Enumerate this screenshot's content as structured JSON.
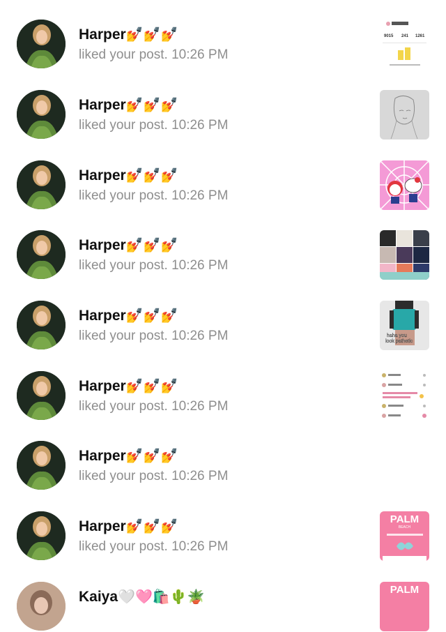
{
  "notifications": [
    {
      "user": "Harper",
      "emoji": "💅💅💅",
      "action": "liked your post.",
      "time": "10:26 PM",
      "thumb": "stats-screenshot",
      "thumb_text": [
        "9015",
        "241",
        "1261"
      ]
    },
    {
      "user": "Harper",
      "emoji": "💅💅💅",
      "action": "liked your post.",
      "time": "10:26 PM",
      "thumb": "pencil-sketch"
    },
    {
      "user": "Harper",
      "emoji": "💅💅💅",
      "action": "liked your post.",
      "time": "10:26 PM",
      "thumb": "pink-cartoon"
    },
    {
      "user": "Harper",
      "emoji": "💅💅💅",
      "action": "liked your post.",
      "time": "10:26 PM",
      "thumb": "photo-collage"
    },
    {
      "user": "Harper",
      "emoji": "💅💅💅",
      "action": "liked your post.",
      "time": "10:26 PM",
      "thumb": "avatar-outfit",
      "thumb_text": [
        "haha you",
        "look pathetic"
      ]
    },
    {
      "user": "Harper",
      "emoji": "💅💅💅",
      "action": "liked your post.",
      "time": "10:26 PM",
      "thumb": "comments-screenshot"
    },
    {
      "user": "Harper",
      "emoji": "💅💅💅",
      "action": "liked your post.",
      "time": "10:26 PM",
      "thumb": "none"
    },
    {
      "user": "Harper",
      "emoji": "💅💅💅",
      "action": "liked your post.",
      "time": "10:26 PM",
      "thumb": "palm-pink",
      "thumb_text": [
        "PALM",
        "BEACH"
      ]
    }
  ],
  "partial": {
    "user": "Kaiya",
    "emoji": "🤍🩷🛍️🌵🪴",
    "thumb": "palm-pink",
    "thumb_text": [
      "PALM"
    ]
  },
  "colors": {
    "name": "#111111",
    "subtext": "#8e8e8e",
    "pink": "#f47fa4"
  }
}
